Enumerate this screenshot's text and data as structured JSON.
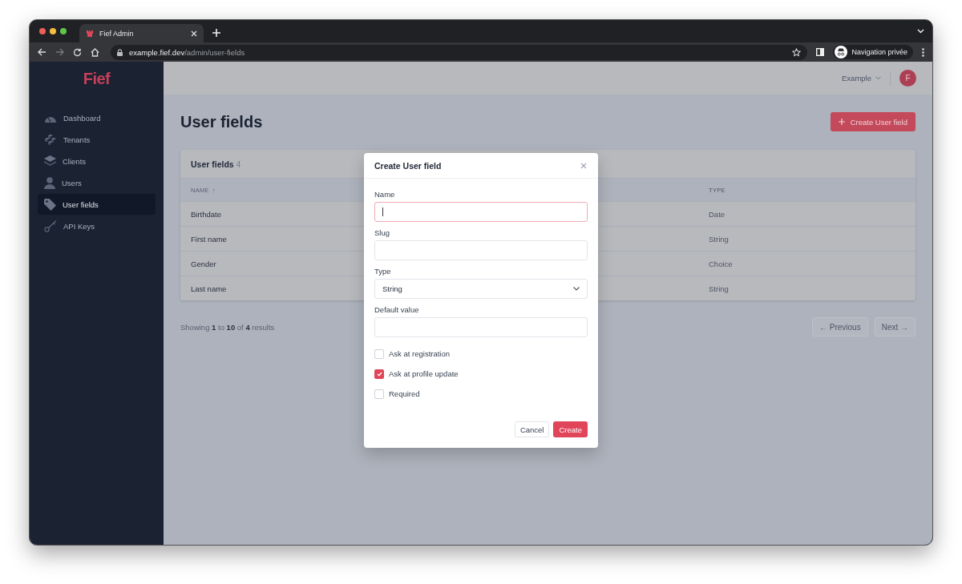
{
  "browser": {
    "tab_title": "Fief Admin",
    "url_host": "example.fief.dev",
    "url_path": "/admin/user-fields",
    "profile_label": "Navigation privée"
  },
  "sidebar": {
    "logo": "Fief",
    "items": [
      {
        "label": "Dashboard",
        "selected": false
      },
      {
        "label": "Tenants",
        "selected": false
      },
      {
        "label": "Clients",
        "selected": false
      },
      {
        "label": "Users",
        "selected": false
      },
      {
        "label": "User fields",
        "selected": true
      },
      {
        "label": "API Keys",
        "selected": false
      }
    ]
  },
  "header": {
    "workspace": "Example",
    "avatar_letter": "F"
  },
  "page": {
    "title": "User fields",
    "create_button": "Create User field"
  },
  "table": {
    "title": "User fields",
    "count": "4",
    "columns": [
      {
        "label": "NAME",
        "sort_indicator": "↑"
      },
      {
        "label": "TYPE"
      }
    ],
    "rows": [
      {
        "name": "Birthdate",
        "type": "Date"
      },
      {
        "name": "First name",
        "type": "String"
      },
      {
        "name": "Gender",
        "type": "Choice"
      },
      {
        "name": "Last name",
        "type": "String"
      }
    ]
  },
  "pagination": {
    "summary": "Showing **1** to **10** of **4** results",
    "previous": "← Previous",
    "next": "Next →",
    "previous_disabled": true,
    "next_disabled": true
  },
  "modal": {
    "title": "Create User field",
    "fields": [
      {
        "kind": "text",
        "label": "Name",
        "focused": true
      },
      {
        "kind": "text",
        "label": "Slug",
        "focused": false
      },
      {
        "kind": "select",
        "label": "Type",
        "value": "String",
        "focused": false
      },
      {
        "kind": "text",
        "label": "Default value",
        "focused": false
      }
    ],
    "checkboxes": [
      {
        "label": "Ask at registration",
        "checked": false
      },
      {
        "label": "Ask at profile update",
        "checked": true
      },
      {
        "label": "Required",
        "checked": false
      }
    ],
    "cancel": "Cancel",
    "submit": "Create"
  }
}
